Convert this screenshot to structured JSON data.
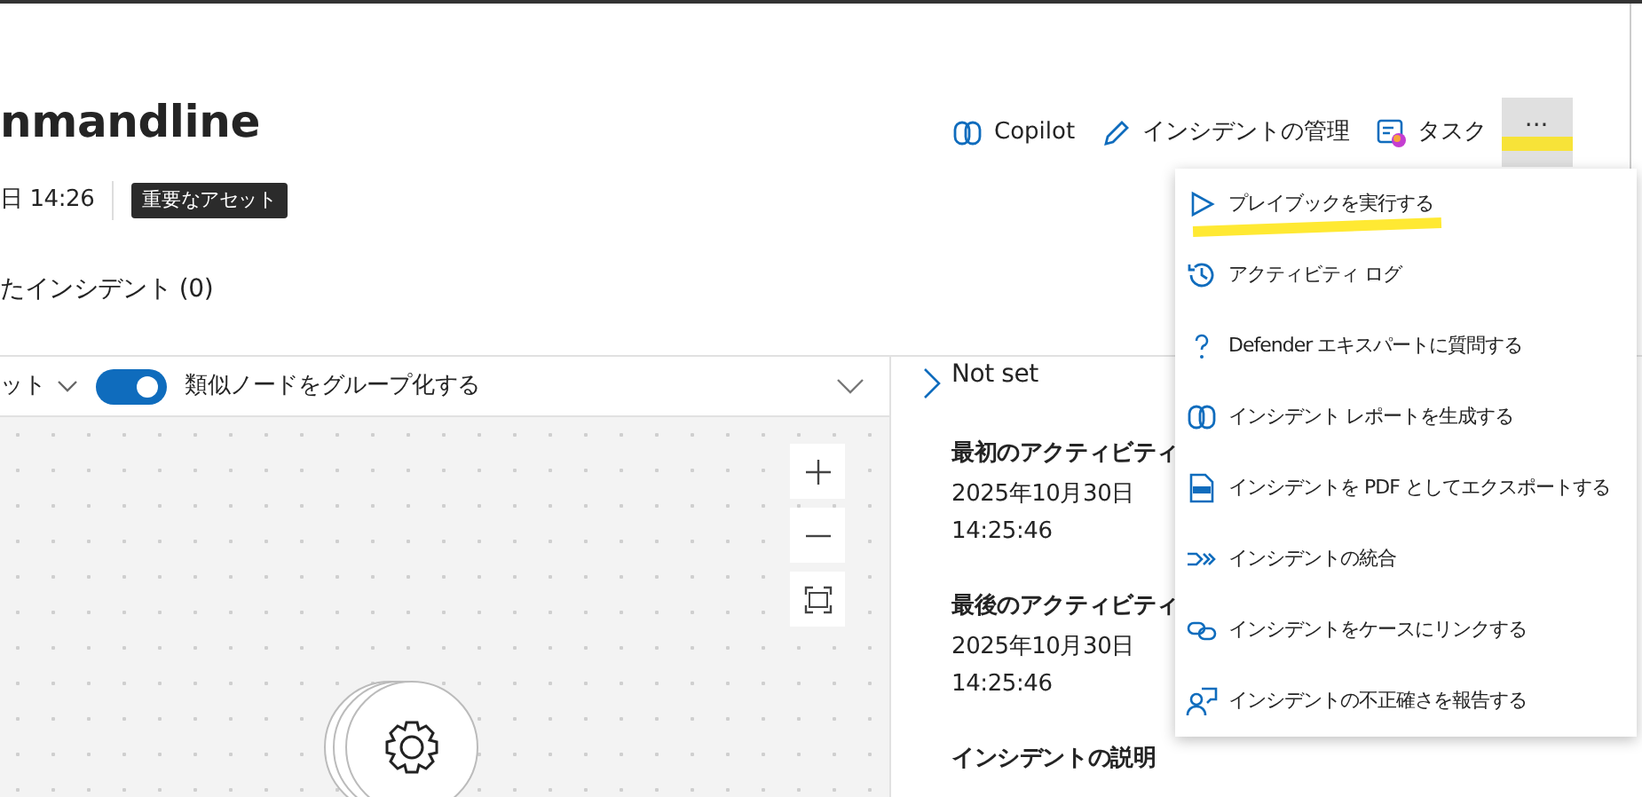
{
  "header": {
    "title": "nmandline",
    "date": "日 14:26",
    "badge": "重要なアセット",
    "related": "たインシデント (0)"
  },
  "actions": [
    {
      "kind": "copilot",
      "label": "Copilot"
    },
    {
      "kind": "edit",
      "label": "インシデントの管理"
    },
    {
      "kind": "tasks",
      "label": "タスク"
    }
  ],
  "more_button": {
    "label": "···",
    "expanded": true,
    "highlighted": true
  },
  "menu": [
    {
      "kind": "play",
      "label": "プレイブックを実行する",
      "highlighted": true
    },
    {
      "kind": "history",
      "label": "アクティビティ ログ",
      "highlighted": false
    },
    {
      "kind": "question",
      "label": "Defender エキスパートに質問する",
      "highlighted": false
    },
    {
      "kind": "copilot",
      "label": "インシデント レポートを生成する",
      "highlighted": false
    },
    {
      "kind": "pdf",
      "label": "インシデントを PDF としてエクスポートする",
      "highlighted": false
    },
    {
      "kind": "merge",
      "label": "インシデントの統合",
      "highlighted": false
    },
    {
      "kind": "link",
      "label": "インシデントをケースにリンクする",
      "highlighted": false
    },
    {
      "kind": "report",
      "label": "インシデントの不正確さを報告する",
      "highlighted": false
    }
  ],
  "graph_toolbar": {
    "layout": "ット",
    "group_toggle": {
      "label": "類似ノードをグループ化する",
      "on": true
    }
  },
  "details": {
    "status": "Not set",
    "fields": [
      {
        "label": "最初のアクティビティ",
        "date": "2025年10月30日",
        "time": "14:25:46"
      },
      {
        "label": "最後のアクティビティ",
        "date": "2025年10月30日",
        "time": "14:25:46"
      },
      {
        "label": "インシデントの説明"
      }
    ]
  }
}
